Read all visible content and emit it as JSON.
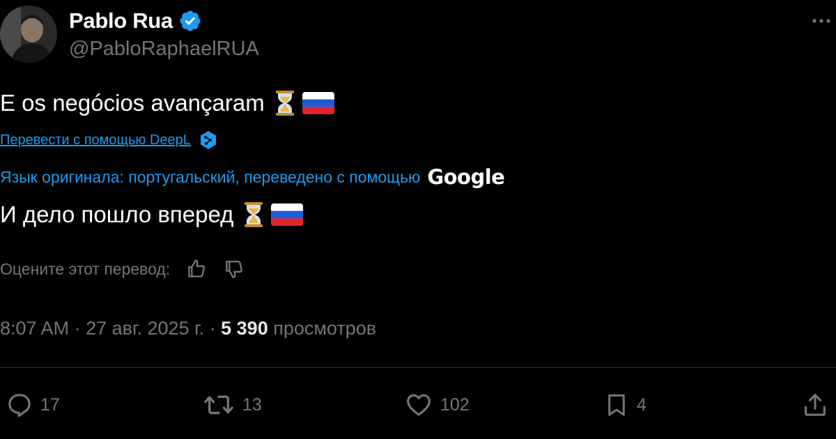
{
  "author": {
    "display_name": "Pablo Rua",
    "handle": "@PabloRaphaelRUA",
    "verified_icon": "verified-badge-icon"
  },
  "tweet": {
    "text": "E os negócios avançaram",
    "emojis": [
      "hourglass",
      "russia-flag"
    ]
  },
  "translation": {
    "deepl_link": "Перевести с помощью DeepL",
    "original_language_note": "Язык оригинала: португальский, переведено с помощью",
    "provider_logo": "Google",
    "translated_text": "И дело пошло вперед",
    "rate_prompt": "Оцените этот перевод:"
  },
  "meta": {
    "time": "8:07 AM",
    "separator1": " · ",
    "date": "27 авг. 2025 г.",
    "separator2": " · ",
    "views_count": "5 390",
    "views_label": " просмотров"
  },
  "actions": {
    "replies": "17",
    "reposts": "13",
    "likes": "102",
    "bookmarks": "4"
  },
  "colors": {
    "background": "#000000",
    "accent": "#1d9bf0",
    "text_primary": "#e7e9ea",
    "text_secondary": "#71767b",
    "divider": "#2f3336"
  }
}
